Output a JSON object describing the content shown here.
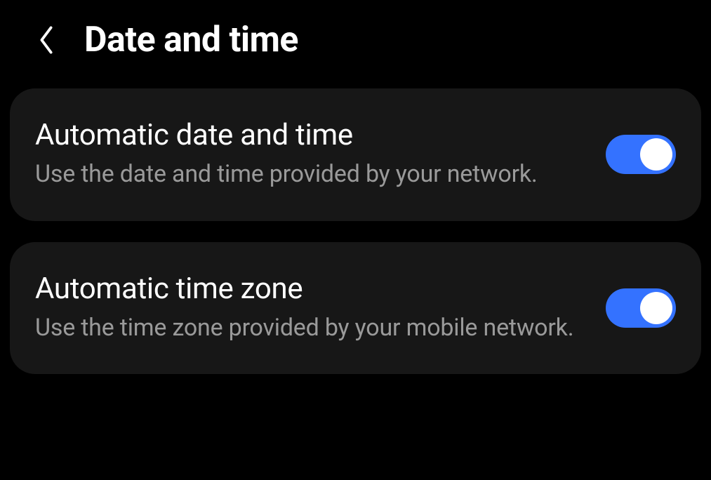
{
  "header": {
    "title": "Date and time"
  },
  "settings": [
    {
      "title": "Automatic date and time",
      "description": "Use the date and time provided by your network.",
      "enabled": true
    },
    {
      "title": "Automatic time zone",
      "description": "Use the time zone provided by your mobile network.",
      "enabled": true
    }
  ]
}
